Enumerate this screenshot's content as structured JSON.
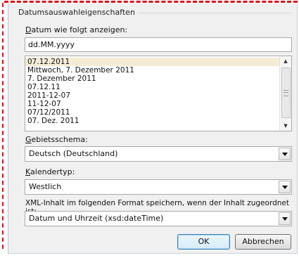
{
  "group": {
    "legend": "Datumsauswahleigenschaften"
  },
  "format": {
    "label_accel": "D",
    "label_rest": "atum wie folgt anzeigen:",
    "value": "dd.MM.yyyy",
    "list_items": [
      "07.12.2011",
      "Mittwoch, 7. Dezember 2011",
      "7. Dezember 2011",
      "07.12.11",
      "2011-12-07",
      "11-12-07",
      "07/12/2011",
      "07. Dez. 2011"
    ],
    "selected_index": 0
  },
  "locale": {
    "label_accel": "G",
    "label_rest": "ebietsschema:",
    "value": "Deutsch (Deutschland)"
  },
  "calendar": {
    "label_accel": "K",
    "label_rest": "alendertyp:",
    "value": "Westlich"
  },
  "xml": {
    "label": "XML-Inhalt im folgenden Format speichern, wenn der Inhalt zugeordnet ist:",
    "value": "Datum und Uhrzeit (xsd:dateTime)"
  },
  "buttons": {
    "ok": "OK",
    "cancel": "Abbrechen"
  },
  "colors": {
    "highlight_dashes": "#e0101a",
    "selected_row": "#f5ecd6"
  }
}
